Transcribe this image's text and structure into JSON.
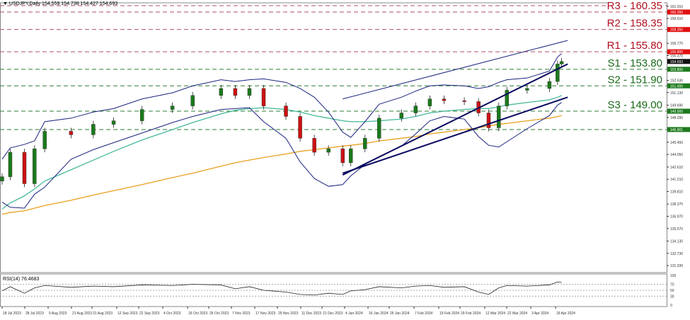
{
  "header": {
    "symbol_label": "USDJPY,Daily 154.559 154.738 154.427 154.693"
  },
  "rsi_header": {
    "label": "RSI(14) 76.4683"
  },
  "chart_data": {
    "type": "candlestick",
    "colors": {
      "bull": "#1a7a1a",
      "bear": "#cc1111",
      "resistance": "#b05060",
      "support": "#2e7d32",
      "ma100": "#45b89a",
      "ma200": "#e8a020",
      "bands": "#1a237e",
      "trend": "#0a0a60"
    },
    "price_axis": {
      "min": 131.33,
      "max": 161.01,
      "ticks": [
        "161.010",
        "159.610",
        "156.770",
        "155.370",
        "152.530",
        "151.130",
        "149.690",
        "148.290",
        "145.450",
        "144.050",
        "142.610",
        "141.210",
        "139.810",
        "138.370",
        "136.970",
        "135.570",
        "134.130",
        "132.730",
        "131.330"
      ]
    },
    "last_price": "154.693",
    "x_ticks": [
      "18 Jul 2023",
      "28 Jul 2023",
      "9 Aug 2023",
      "21 Aug 2023",
      "31 Aug 2023",
      "12 Sep 2023",
      "22 Sep 2023",
      "4 Oct 2023",
      "16 Oct 2023",
      "26 Oct 2023",
      "7 Nov 2023",
      "17 Nov 2023",
      "29 Nov 2023",
      "11 Dec 2023",
      "21 Dec 2023",
      "4 Jan 2024",
      "16 Jan 2024",
      "26 Jan 2024",
      "7 Feb 2024",
      "19 Feb 2024",
      "29 Feb 2024",
      "12 Mar 2024",
      "22 Mar 2024",
      "3 Apr 2024",
      "16 Apr 2024"
    ],
    "x": [
      "2023-07-18",
      "2023-07-22",
      "2023-07-29",
      "2023-08-03",
      "2023-08-08",
      "2023-08-21",
      "2023-09-01",
      "2023-09-11",
      "2023-09-25",
      "2023-10-10",
      "2023-10-20",
      "2023-11-03",
      "2023-11-10",
      "2023-11-17",
      "2023-11-24",
      "2023-12-05",
      "2023-12-12",
      "2023-12-19",
      "2023-12-26",
      "2024-01-02",
      "2024-01-06",
      "2024-01-13",
      "2024-01-20",
      "2024-01-31",
      "2024-02-07",
      "2024-02-14",
      "2024-02-21",
      "2024-03-02",
      "2024-03-09",
      "2024-03-14",
      "2024-03-19",
      "2024-03-23",
      "2024-04-02",
      "2024-04-13",
      "2024-04-17",
      "2024-04-19"
    ],
    "close": [
      141.5,
      144.3,
      140.7,
      144.7,
      146.7,
      146.3,
      147.5,
      147.9,
      149.2,
      149.6,
      150.8,
      151.6,
      150.8,
      151.6,
      149.6,
      148.4,
      145.9,
      144.3,
      144.7,
      143.1,
      144.7,
      145.9,
      148.2,
      148.8,
      149.6,
      150.4,
      150.2,
      150.1,
      148.8,
      147.1,
      149.6,
      151.4,
      151.6,
      152.4,
      154.4,
      154.693
    ],
    "ma100": [
      137.8,
      138.5,
      139.3,
      140.1,
      141.0,
      142.3,
      143.4,
      144.4,
      145.7,
      146.9,
      147.7,
      148.7,
      149.1,
      149.3,
      149.4,
      149.2,
      148.9,
      148.5,
      148.2,
      147.9,
      147.8,
      147.8,
      147.9,
      148.1,
      148.4,
      148.8,
      149.0,
      149.2,
      149.3,
      149.3,
      149.5,
      149.7,
      150.0,
      150.3,
      150.6,
      150.8
    ],
    "ma200": [
      137.2,
      137.4,
      137.6,
      137.9,
      138.2,
      138.8,
      139.4,
      139.9,
      140.6,
      141.4,
      141.9,
      142.7,
      143.1,
      143.4,
      143.7,
      144.1,
      144.4,
      144.6,
      144.8,
      145.0,
      145.1,
      145.3,
      145.6,
      145.9,
      146.1,
      146.4,
      146.6,
      146.9,
      147.1,
      147.3,
      147.5,
      147.6,
      147.9,
      148.2,
      148.4,
      148.5
    ],
    "bb_upper": [
      143.5,
      144.8,
      145.2,
      145.6,
      147.8,
      148.2,
      148.9,
      149.3,
      150.4,
      151.1,
      151.9,
      152.6,
      152.4,
      152.6,
      152.7,
      152.3,
      151.6,
      150.6,
      148.9,
      146.6,
      146.0,
      147.8,
      149.8,
      150.6,
      151.3,
      151.9,
      152.0,
      151.9,
      151.6,
      151.8,
      152.3,
      152.6,
      152.8,
      153.6,
      155.2,
      155.6
    ],
    "bb_lower": [
      138.6,
      138.0,
      137.9,
      139.5,
      140.3,
      143.5,
      144.6,
      145.4,
      146.5,
      147.7,
      148.4,
      149.2,
      149.3,
      149.4,
      147.8,
      145.9,
      143.2,
      141.3,
      140.4,
      140.6,
      141.6,
      142.9,
      143.8,
      145.0,
      146.4,
      147.9,
      148.4,
      148.1,
      146.1,
      145.1,
      144.9,
      145.5,
      147.0,
      148.5,
      149.7,
      150.0
    ],
    "rsi": [
      48,
      62,
      40,
      58,
      66,
      60,
      64,
      62,
      68,
      66,
      70,
      68,
      55,
      62,
      50,
      44,
      36,
      34,
      40,
      36,
      48,
      52,
      62,
      58,
      64,
      66,
      60,
      62,
      44,
      36,
      58,
      66,
      64,
      68,
      78,
      76.47
    ],
    "rsi_axis": {
      "min": 0,
      "max": 100,
      "ticks": [
        "100",
        "70",
        "50",
        "30",
        "0"
      ]
    },
    "levels": [
      {
        "label": "R3 - 160.35",
        "value": 160.35,
        "axis": "160.350",
        "kind": "resistance"
      },
      {
        "label": "R2 - 158.35",
        "value": 158.35,
        "axis": "158.350",
        "kind": "resistance"
      },
      {
        "label": "R1 - 155.80",
        "value": 155.8,
        "axis": "155.800",
        "kind": "resistance"
      },
      {
        "label": "S1 - 153.80",
        "value": 153.8,
        "axis": "153.800",
        "kind": "support"
      },
      {
        "label": "S2 - 151.90",
        "value": 151.9,
        "axis": "151.900",
        "kind": "support"
      },
      {
        "label": "S3 - 149.00",
        "value": 149.0,
        "axis": "149.000",
        "kind": "support"
      },
      {
        "label": "",
        "value": 146.9,
        "axis": "146.901",
        "kind": "support"
      }
    ],
    "trendlines": [
      {
        "name": "channel-upper",
        "from": [
          "2024-01-02",
          150.4
        ],
        "to": [
          "2024-04-22",
          157.1
        ],
        "width": 1
      },
      {
        "name": "uptrend-main",
        "from": [
          "2024-01-02",
          141.7
        ],
        "to": [
          "2024-04-22",
          154.4
        ],
        "width": 2
      },
      {
        "name": "uptrend-secondary",
        "from": [
          "2024-01-02",
          141.9
        ],
        "to": [
          "2024-04-22",
          150.6
        ],
        "width": 2
      }
    ]
  }
}
